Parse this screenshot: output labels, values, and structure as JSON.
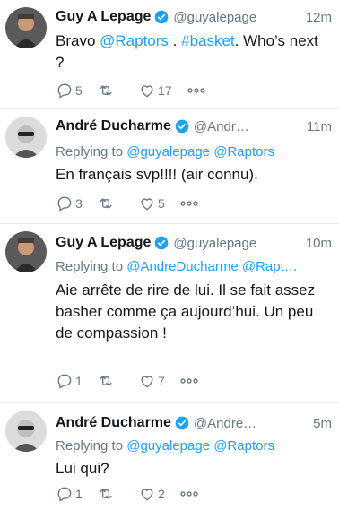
{
  "tweets": [
    {
      "name": "Guy A Lepage",
      "handle": "@guyalepage",
      "time": "12m",
      "reply_label": "",
      "reply_mentions": [],
      "text_parts": [
        "Bravo ",
        "@Raptors",
        " . ",
        "#basket",
        ". Who’s next ?"
      ],
      "replies": "5",
      "retweets": "",
      "likes": "17"
    },
    {
      "name": "André Ducharme",
      "handle": "@Andr…",
      "time": "11m",
      "reply_label": "Replying to",
      "reply_mentions": [
        "@guyalepage",
        "@Raptors"
      ],
      "text_parts": [
        "En français svp!!!! (air connu)."
      ],
      "replies": "3",
      "retweets": "",
      "likes": "5"
    },
    {
      "name": "Guy A Lepage",
      "handle": "@guyalepage",
      "time": "10m",
      "reply_label": "Replying to",
      "reply_mentions": [
        "@AndreDucharme",
        "@Rapt…"
      ],
      "text_parts": [
        "Aie arrête de rire de lui. Il se fait assez basher comme ça aujourd’hui. Un peu de compassion !"
      ],
      "replies": "1",
      "retweets": "",
      "likes": "7"
    },
    {
      "name": "André Ducharme",
      "handle": "@Andre…",
      "time": "5m",
      "reply_label": "Replying to",
      "reply_mentions": [
        "@guyalepage",
        "@Raptors"
      ],
      "text_parts": [
        "Lui qui?"
      ],
      "replies": "1",
      "retweets": "",
      "likes": "2"
    }
  ],
  "colors": {
    "link": "#1da1f2",
    "muted": "#657786",
    "text": "#14171a",
    "verified": "#1da1f2"
  },
  "icons": [
    "reply-icon",
    "retweet-icon",
    "like-icon",
    "more-icon",
    "verified-icon"
  ]
}
